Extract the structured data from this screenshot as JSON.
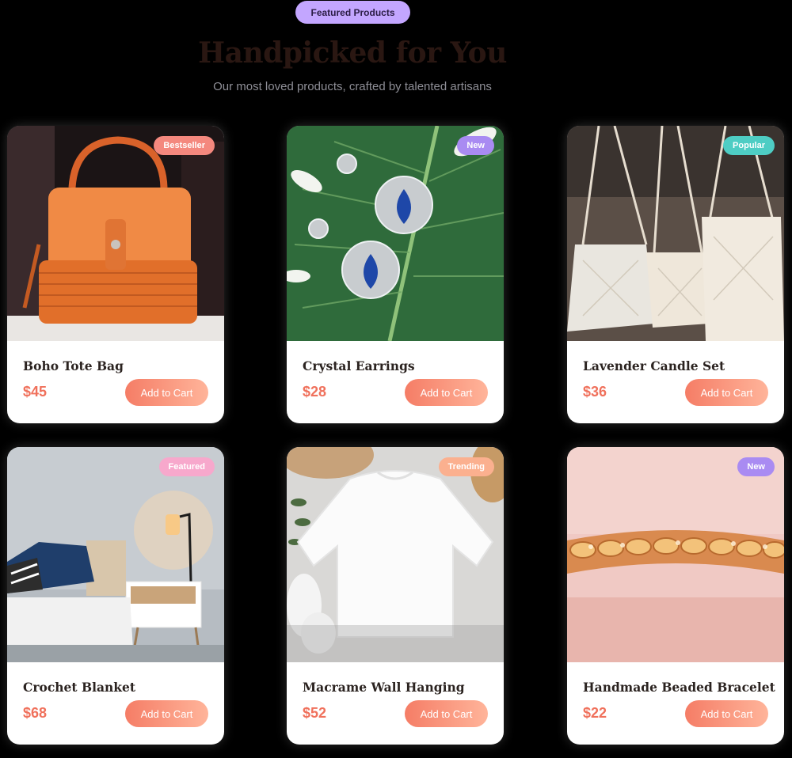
{
  "header": {
    "pill": "Featured Products",
    "title": "Handpicked for You",
    "subtitle": "Our most loved products, crafted by talented artisans"
  },
  "products": [
    {
      "name": "Boho Tote Bag",
      "price": "$45",
      "badge": "Bestseller",
      "badge_color": "#f4887e",
      "image": "orange-wicker-handbag",
      "button": "Add to Cart"
    },
    {
      "name": "Crystal Earrings",
      "price": "$28",
      "badge": "New",
      "badge_color": "#a98bf2",
      "image": "crystal-earrings-on-leaf",
      "button": "Add to Cart"
    },
    {
      "name": "Lavender Candle Set",
      "price": "$36",
      "badge": "Popular",
      "badge_color": "#4ecdc4",
      "image": "hanging-macrame-bags",
      "button": "Add to Cart"
    },
    {
      "name": "Crochet Blanket",
      "price": "$68",
      "badge": "Featured",
      "badge_color": "#f7a8cc",
      "image": "bedroom-with-lamp",
      "button": "Add to Cart"
    },
    {
      "name": "Macrame Wall Hanging",
      "price": "$52",
      "badge": "Trending",
      "badge_color": "#fbb08f",
      "image": "white-sweatshirt-flatlay",
      "button": "Add to Cart"
    },
    {
      "name": "Handmade Beaded Bracelet",
      "price": "$22",
      "badge": "New",
      "badge_color": "#a98bf2",
      "image": "gold-beaded-bracelet",
      "button": "Add to Cart"
    }
  ]
}
